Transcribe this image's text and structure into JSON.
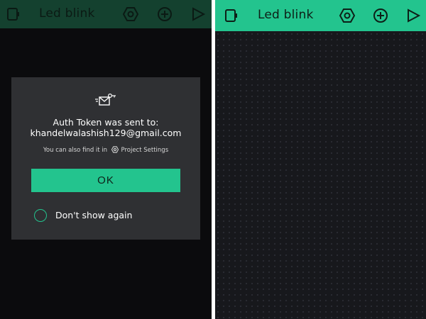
{
  "left_screen": {
    "header": {
      "title": "Led blink"
    },
    "dialog": {
      "message_line1": "Auth Token was sent to:",
      "message_line2": "khandelwalashish129@gmail.com",
      "hint_prefix": "You can also find it in",
      "hint_link": "Project Settings",
      "ok_label": "OK",
      "dont_show_label": "Don't show again",
      "dont_show_checked": false
    }
  },
  "right_screen": {
    "header": {
      "title": "Led blink"
    }
  },
  "colors": {
    "accent": "#23c48e",
    "dim_header": "#14412f",
    "canvas": "#17181c",
    "dialog": "#2f3033"
  },
  "icons": [
    "device-icon",
    "settings-icon",
    "add-icon",
    "play-icon",
    "mail-token-icon"
  ]
}
